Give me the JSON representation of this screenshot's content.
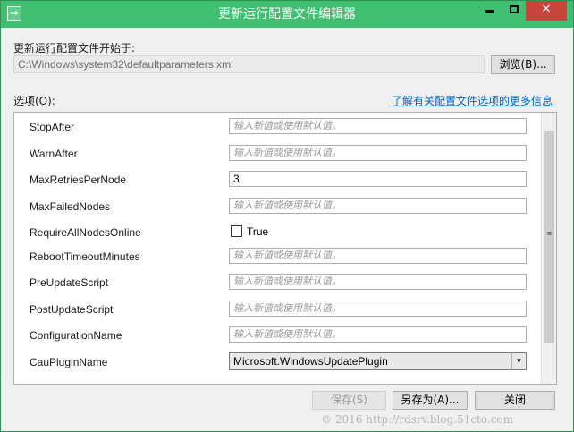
{
  "window": {
    "title": "更新运行配置文件编辑器",
    "app_icon": "⇒",
    "accent": "#3fbf6f",
    "close_glyph": "✕"
  },
  "profile": {
    "start_label": "更新运行配置文件开始于:",
    "path": "C:\\Windows\\system32\\defaultparameters.xml",
    "browse_label": "浏览(B)..."
  },
  "options": {
    "label": "选项(O):",
    "link_text": "了解有关配置文件选项的更多信息",
    "placeholder": "输入新值或使用默认值。",
    "rows": [
      {
        "name": "StopAfter",
        "value": ""
      },
      {
        "name": "WarnAfter",
        "value": ""
      },
      {
        "name": "MaxRetriesPerNode",
        "value": "3"
      },
      {
        "name": "MaxFailedNodes",
        "value": ""
      },
      {
        "name": "RequireAllNodesOnline",
        "checkbox_label": "True"
      },
      {
        "name": "RebootTimeoutMinutes",
        "value": ""
      },
      {
        "name": "PreUpdateScript",
        "value": ""
      },
      {
        "name": "PostUpdateScript",
        "value": ""
      },
      {
        "name": "ConfigurationName",
        "value": ""
      },
      {
        "name": "CauPluginName",
        "selected": "Microsoft.WindowsUpdatePlugin"
      }
    ]
  },
  "buttons": {
    "save": "保存(S)",
    "save_as": "另存为(A)...",
    "close": "关闭"
  },
  "watermark": "© 2016 http://rdsrv.blog.51cto.com"
}
